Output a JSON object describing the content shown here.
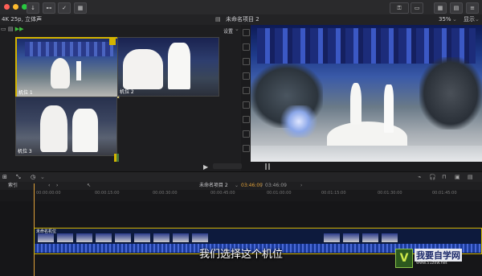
{
  "toolbar_top": {
    "buttons": [
      "↓",
      "⊷",
      "✓",
      "▦"
    ]
  },
  "info": {
    "format": "4K 25p, 立体声",
    "project_name": "未命名项目 2",
    "zoom": "35%",
    "view_menu": "显示"
  },
  "angle_viewer": {
    "settings_label": "设置",
    "angles": [
      {
        "label": "机位 1"
      },
      {
        "label": "机位 2"
      },
      {
        "label": "机位 3"
      }
    ]
  },
  "timeline": {
    "index_label": "索引",
    "project_name": "未命名项目 2",
    "timecode": "03:46:09",
    "duration": "03:46:09",
    "clip_label": "未命名机位",
    "ruler": [
      "00:00:00:00",
      "00:00:15:00",
      "00:00:30:00",
      "00:00:45:00",
      "00:01:00:00",
      "00:01:15:00",
      "00:01:30:00",
      "00:01:45:00"
    ]
  },
  "subtitle": "我们选择这个机位",
  "watermark": {
    "name": "我要自学网",
    "url": "www.51zxw.net"
  },
  "colors": {
    "accent_yellow": "#d4b400",
    "playhead": "#e0a13a",
    "clip_bg": "#0d1a3d"
  }
}
